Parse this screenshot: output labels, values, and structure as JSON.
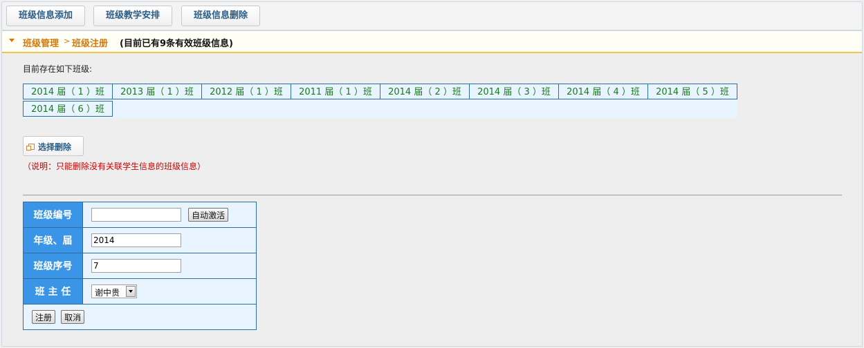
{
  "toolbar": {
    "buttons": [
      "班级信息添加",
      "班级教学安排",
      "班级信息删除"
    ]
  },
  "breadcrumb": {
    "level1": "班级管理",
    "separator": ">",
    "level2": "班级注册",
    "count_text": "(目前已有9条有效班级信息)"
  },
  "existing": {
    "label": "目前存在如下班级:",
    "classes": [
      "2014 届（ 1 ）班",
      "2013 届（ 1 ）班",
      "2012 届（ 1 ）班",
      "2011 届（ 1 ）班",
      "2014 届（ 2 ）班",
      "2014 届（ 3 ）班",
      "2014 届（ 4 ）班",
      "2014 届（ 5 ）班",
      "2014 届（ 6 ）班"
    ]
  },
  "delete": {
    "button_label": "选择删除",
    "note": "（说明：只能删除没有关联学生信息的班级信息）"
  },
  "form": {
    "class_number": {
      "label": "班级编号",
      "value": "",
      "activate_label": "自动激活"
    },
    "grade": {
      "label": "年级、届",
      "value": "2014"
    },
    "class_seq": {
      "label": "班级序号",
      "value": "7"
    },
    "head_teacher": {
      "label": "班 主 任",
      "selected": "谢中贵"
    },
    "submit_label": "注册",
    "cancel_label": "取消"
  },
  "colors": {
    "accent_blue": "#3b95e6",
    "border_blue": "#2e6da4",
    "class_text_green": "#1a7a1a",
    "breadcrumb_orange": "#d07a10",
    "note_red": "#cc0000"
  }
}
